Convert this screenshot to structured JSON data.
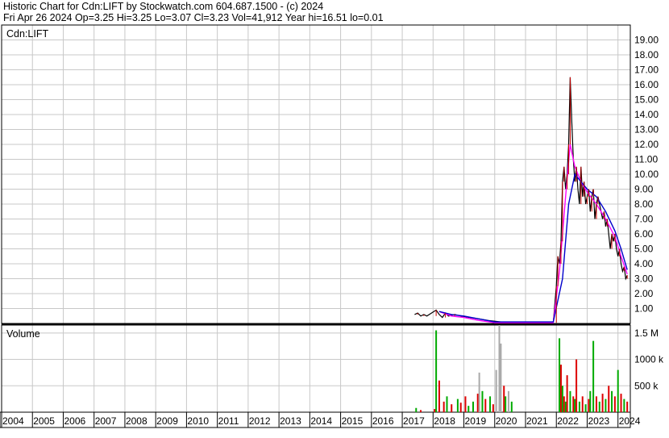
{
  "header": {
    "line1": "Historic Chart for Cdn:LIFT by Stockwatch.com 604.687.1500 - (c) 2024",
    "line2": "Fri Apr 26 2024   Op=3.25  Hi=3.25  Lo=3.07  Cl=3.23  Vol=41,912  Year hi=16.51  lo=0.01"
  },
  "chart_data": [
    {
      "type": "line",
      "name": "price",
      "label": "Cdn:LIFT",
      "x_range": [
        2004,
        2024.4
      ],
      "ylim": [
        0,
        20
      ],
      "y_ticks": [
        "1.00",
        "2.00",
        "3.00",
        "4.00",
        "5.00",
        "6.00",
        "7.00",
        "8.00",
        "9.00",
        "10.00",
        "11.00",
        "12.00",
        "13.00",
        "14.00",
        "15.00",
        "16.00",
        "17.00",
        "18.00",
        "19.00"
      ],
      "x_tick_labels": [
        "2004",
        "2005",
        "2006",
        "2007",
        "2008",
        "2009",
        "2010",
        "2011",
        "2012",
        "2013",
        "2014",
        "2015",
        "2016",
        "2017",
        "2018",
        "2019",
        "2020",
        "2021",
        "2022",
        "2023",
        "2024"
      ],
      "grid": true,
      "colors": {
        "price": "#000000",
        "up": "#cc0000",
        "ma_short": "#ff00ff",
        "ma_long": "#0000cc"
      },
      "series": [
        {
          "key": "price",
          "x": [
            2017.4,
            2017.5,
            2017.6,
            2017.7,
            2017.8,
            2018.1,
            2018.2,
            2018.3,
            2018.4,
            2018.5,
            2018.7,
            2018.9,
            2019.2,
            2019.5,
            2019.8,
            2020.2,
            2020.6,
            2021.0,
            2021.4,
            2021.9,
            2022.0,
            2022.05,
            2022.1,
            2022.15,
            2022.2,
            2022.25,
            2022.3,
            2022.35,
            2022.4,
            2022.45,
            2022.5,
            2022.55,
            2022.6,
            2022.65,
            2022.7,
            2022.75,
            2022.8,
            2022.85,
            2022.9,
            2022.95,
            2023.0,
            2023.05,
            2023.1,
            2023.15,
            2023.2,
            2023.25,
            2023.3,
            2023.35,
            2023.4,
            2023.45,
            2023.5,
            2023.55,
            2023.6,
            2023.65,
            2023.7,
            2023.75,
            2023.8,
            2023.85,
            2023.9,
            2023.95,
            2024.0,
            2024.05,
            2024.1,
            2024.15,
            2024.2,
            2024.25,
            2024.3
          ],
          "y": [
            0.6,
            0.7,
            0.5,
            0.6,
            0.5,
            0.9,
            0.6,
            0.4,
            0.7,
            0.5,
            0.6,
            0.5,
            0.4,
            0.3,
            0.2,
            0.1,
            0.08,
            0.05,
            0.05,
            0.05,
            2.5,
            4.5,
            4.0,
            5.5,
            9.5,
            10.5,
            9.0,
            10.0,
            12.0,
            16.5,
            13.5,
            11.0,
            9.5,
            10.5,
            9.0,
            8.0,
            10.5,
            8.5,
            9.5,
            8.0,
            8.5,
            9.0,
            7.5,
            8.5,
            9.0,
            7.0,
            8.0,
            8.5,
            8.0,
            7.5,
            7.0,
            7.5,
            6.5,
            7.0,
            6.0,
            5.0,
            6.0,
            5.5,
            6.0,
            5.0,
            4.5,
            5.0,
            4.0,
            3.5,
            3.8,
            3.0,
            3.23
          ]
        },
        {
          "key": "ma_short",
          "x": [
            2018.2,
            2018.6,
            2019.0,
            2019.5,
            2020.0,
            2021.9,
            2022.1,
            2022.3,
            2022.45,
            2022.6,
            2022.8,
            2023.0,
            2023.3,
            2023.6,
            2023.9,
            2024.1,
            2024.3
          ],
          "y": [
            0.8,
            0.5,
            0.4,
            0.2,
            0.05,
            0.05,
            3.5,
            8.5,
            12.0,
            10.5,
            9.5,
            8.8,
            8.0,
            7.0,
            5.8,
            4.5,
            3.3
          ]
        },
        {
          "key": "ma_long",
          "x": [
            2018.2,
            2018.6,
            2019.0,
            2019.5,
            2020.0,
            2021.9,
            2022.2,
            2022.4,
            2022.6,
            2022.8,
            2023.0,
            2023.3,
            2023.6,
            2023.9,
            2024.1,
            2024.3
          ],
          "y": [
            0.8,
            0.6,
            0.5,
            0.3,
            0.1,
            0.1,
            3.0,
            8.0,
            10.0,
            9.5,
            9.0,
            8.5,
            7.5,
            6.2,
            5.0,
            3.6
          ]
        }
      ]
    },
    {
      "type": "bar",
      "name": "volume",
      "label": "Volume",
      "ylim": [
        0,
        1650000
      ],
      "y_ticks": [
        "500 k",
        "1000 k",
        "1.5 M"
      ],
      "y_tick_values": [
        500000,
        1000000,
        1500000
      ],
      "x_range": [
        2004,
        2024.4
      ],
      "grid": true,
      "colors": {
        "up": "#00aa00",
        "down": "#dd0000",
        "neutral": "#aaaaaa"
      },
      "bars": {
        "x": [
          2017.45,
          2017.6,
          2018.05,
          2018.1,
          2018.2,
          2018.35,
          2018.45,
          2018.6,
          2018.8,
          2018.9,
          2019.05,
          2019.15,
          2019.3,
          2019.45,
          2019.5,
          2019.6,
          2019.7,
          2019.85,
          2019.95,
          2020.05,
          2020.15,
          2020.2,
          2020.3,
          2020.35,
          2020.45,
          2020.55,
          2022.1,
          2022.15,
          2022.2,
          2022.25,
          2022.3,
          2022.35,
          2022.45,
          2022.55,
          2022.6,
          2022.65,
          2022.75,
          2022.85,
          2022.95,
          2023.05,
          2023.1,
          2023.2,
          2023.3,
          2023.4,
          2023.5,
          2023.6,
          2023.7,
          2023.8,
          2023.9,
          2024.0,
          2024.1,
          2024.2,
          2024.3
        ],
        "v": [
          80000,
          40000,
          60000,
          1550000,
          600000,
          200000,
          300000,
          150000,
          250000,
          180000,
          300000,
          120000,
          200000,
          350000,
          750000,
          400000,
          250000,
          300000,
          150000,
          800000,
          1650000,
          1300000,
          500000,
          300000,
          400000,
          200000,
          1400000,
          900000,
          500000,
          300000,
          200000,
          700000,
          400000,
          300000,
          250000,
          1000000,
          200000,
          300000,
          150000,
          250000,
          400000,
          1350000,
          300000,
          200000,
          350000,
          250000,
          500000,
          400000,
          300000,
          800000,
          350000,
          250000,
          200000
        ],
        "c": [
          "up",
          "down",
          "down",
          "up",
          "down",
          "down",
          "up",
          "down",
          "up",
          "down",
          "down",
          "up",
          "up",
          "down",
          "neutral",
          "up",
          "down",
          "up",
          "down",
          "neutral",
          "neutral",
          "neutral",
          "down",
          "up",
          "neutral",
          "up",
          "up",
          "down",
          "up",
          "down",
          "up",
          "down",
          "up",
          "down",
          "up",
          "down",
          "up",
          "down",
          "up",
          "down",
          "up",
          "up",
          "down",
          "up",
          "down",
          "up",
          "down",
          "up",
          "down",
          "up",
          "down",
          "up",
          "down"
        ]
      }
    }
  ]
}
